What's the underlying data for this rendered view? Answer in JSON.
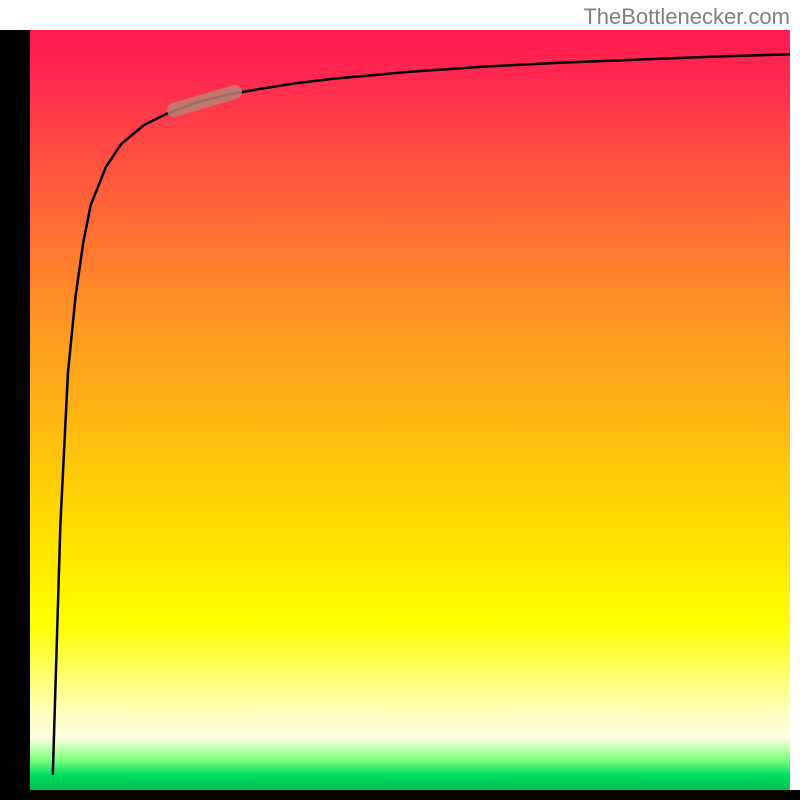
{
  "watermark": "TheBottlenecker.com",
  "chart_data": {
    "type": "line",
    "title": "",
    "xlabel": "",
    "ylabel": "",
    "xlim": [
      0,
      100
    ],
    "ylim": [
      0,
      100
    ],
    "series": [
      {
        "name": "bottleneck-curve",
        "x": [
          3,
          4,
          5,
          6,
          7,
          8,
          10,
          12,
          15,
          18,
          22,
          26,
          30,
          35,
          40,
          50,
          60,
          70,
          80,
          90,
          100
        ],
        "values": [
          2,
          35,
          55,
          65,
          72,
          77,
          82,
          85,
          87.5,
          89,
          90.5,
          91.5,
          92.2,
          93,
          93.6,
          94.5,
          95.2,
          95.7,
          96.1,
          96.5,
          96.8
        ]
      }
    ],
    "highlight_segment": {
      "x_start": 19,
      "x_end": 27,
      "description": "highlighted-range"
    },
    "background_gradient": {
      "type": "vertical",
      "description": "red-to-green-heatmap",
      "stops": [
        {
          "pos": 0,
          "color": "#ff1a4d"
        },
        {
          "pos": 0.5,
          "color": "#ffdc00"
        },
        {
          "pos": 0.95,
          "color": "#ffffc0"
        },
        {
          "pos": 1.0,
          "color": "#00c050"
        }
      ]
    }
  }
}
